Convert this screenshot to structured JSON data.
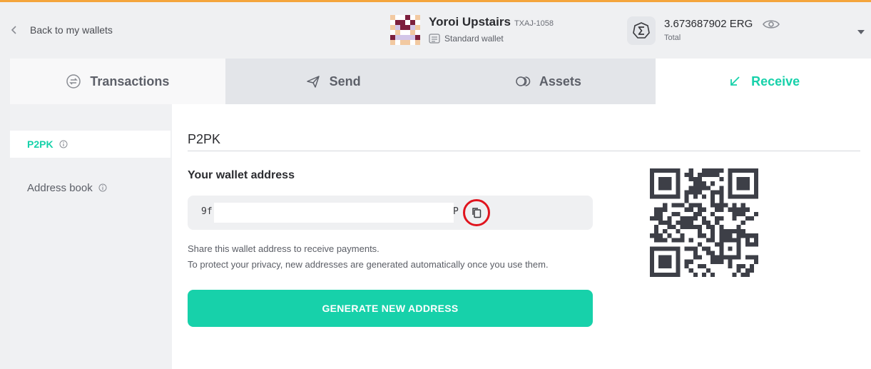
{
  "header": {
    "back_label": "Back to my wallets",
    "wallet": {
      "name": "Yoroi Upstairs",
      "plate": "TXAJ-1058",
      "type": "Standard wallet"
    },
    "balance": {
      "amount": "3.673687902 ERG",
      "label": "Total",
      "currency_icon": "sigma-icon"
    }
  },
  "tabs": [
    {
      "label": "Transactions",
      "icon": "transactions-icon"
    },
    {
      "label": "Send",
      "icon": "send-icon"
    },
    {
      "label": "Assets",
      "icon": "assets-icon"
    },
    {
      "label": "Receive",
      "icon": "receive-icon",
      "active": true
    }
  ],
  "sidebar": {
    "items": [
      {
        "label": "P2PK",
        "active": true
      },
      {
        "label": "Address book"
      }
    ]
  },
  "main": {
    "section_title": "P2PK",
    "address_heading": "Your wallet address",
    "address_start": "9f",
    "address_end": "P",
    "note_line1": "Share this wallet address to receive payments.",
    "note_line2": "To protect your privacy, new addresses are generated automatically once you use them.",
    "generate_button": "GENERATE NEW ADDRESS"
  },
  "colors": {
    "accent": "#17d1aa",
    "top_bar": "#f4a53c",
    "highlight_circle": "#e0141e",
    "qr": "#3d3f47"
  }
}
